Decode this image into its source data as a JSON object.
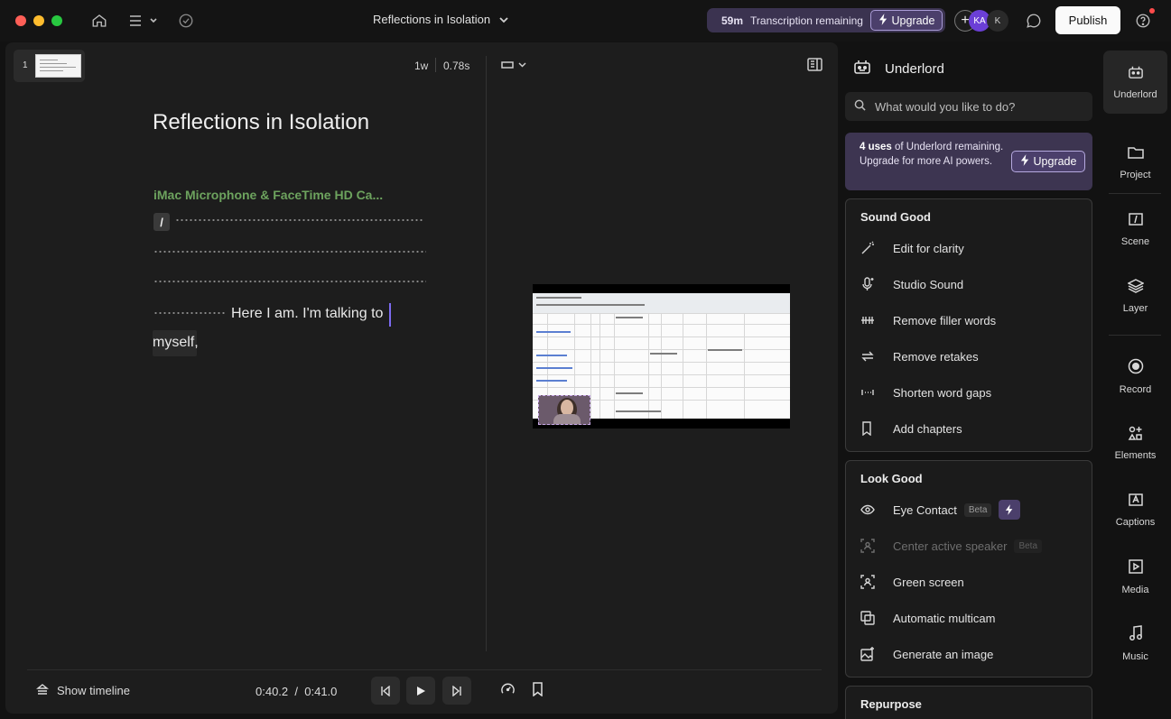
{
  "window": {
    "doc_title": "Reflections in Isolation"
  },
  "topbar": {
    "transcription_time": "59m",
    "transcription_label": "Transcription remaining",
    "upgrade_label": "Upgrade",
    "avatar_1": "KA",
    "avatar_2": "K",
    "publish_label": "Publish"
  },
  "editor": {
    "scene_number": "1",
    "gap_label": "1w",
    "gap_duration": "0.78s",
    "script_title": "Reflections in Isolation",
    "speaker": "iMac Microphone & FaceTime HD Ca...",
    "slash": "/",
    "line_text": "Here I am. I'm talking to",
    "line_text2": "myself,"
  },
  "bottom": {
    "show_timeline": "Show timeline",
    "current_time": "0:40.2",
    "separator": "/",
    "total_time": "0:41.0"
  },
  "underlord": {
    "title": "Underlord",
    "search_placeholder": "What would you like to do?",
    "promo_bold": "4 uses",
    "promo_text": " of Underlord remaining. Upgrade for more AI powers.",
    "promo_upgrade": "Upgrade",
    "sound_good": {
      "title": "Sound Good",
      "items": [
        "Edit for clarity",
        "Studio Sound",
        "Remove filler words",
        "Remove retakes",
        "Shorten word gaps",
        "Add chapters"
      ]
    },
    "look_good": {
      "title": "Look Good",
      "items": [
        "Eye Contact",
        "Center active speaker",
        "Green screen",
        "Automatic multicam",
        "Generate an image"
      ],
      "beta": "Beta"
    },
    "repurpose": {
      "title": "Repurpose"
    }
  },
  "rail": {
    "items": [
      "Underlord",
      "Project",
      "Scene",
      "Layer",
      "Record",
      "Elements",
      "Captions",
      "Media",
      "Music"
    ]
  }
}
